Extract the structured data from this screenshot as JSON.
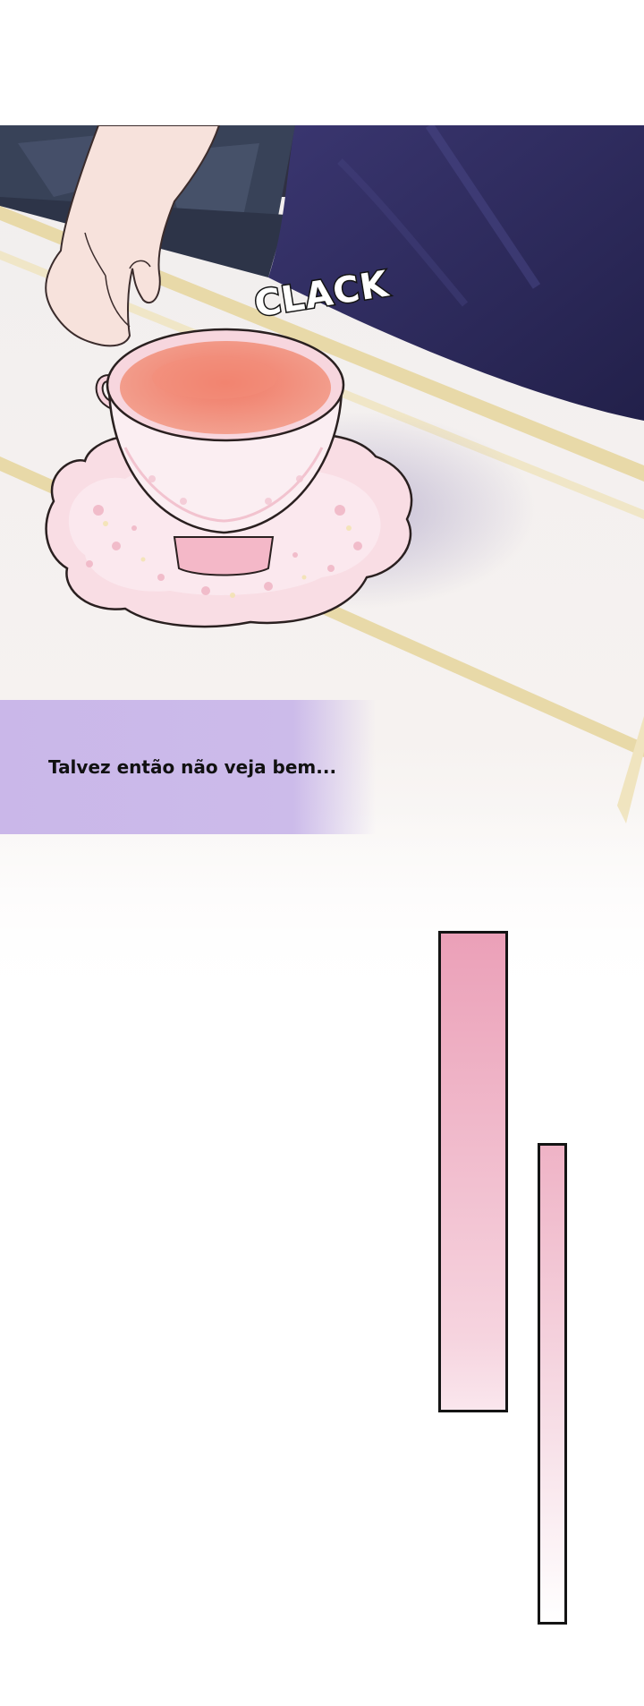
{
  "panel": {
    "sfx_text": "CLACK",
    "caption": "Talvez então não veja bem..."
  },
  "colors": {
    "tablecloth": "#f3efef",
    "gold_stripe": "#e8d9a8",
    "sleeve_navy": "#2e2b5a",
    "tea": "#ee8270",
    "porcelain_pink": "#f8d6de",
    "caption_box": "#ccbbea",
    "accent_bar": "#eba0b8"
  }
}
